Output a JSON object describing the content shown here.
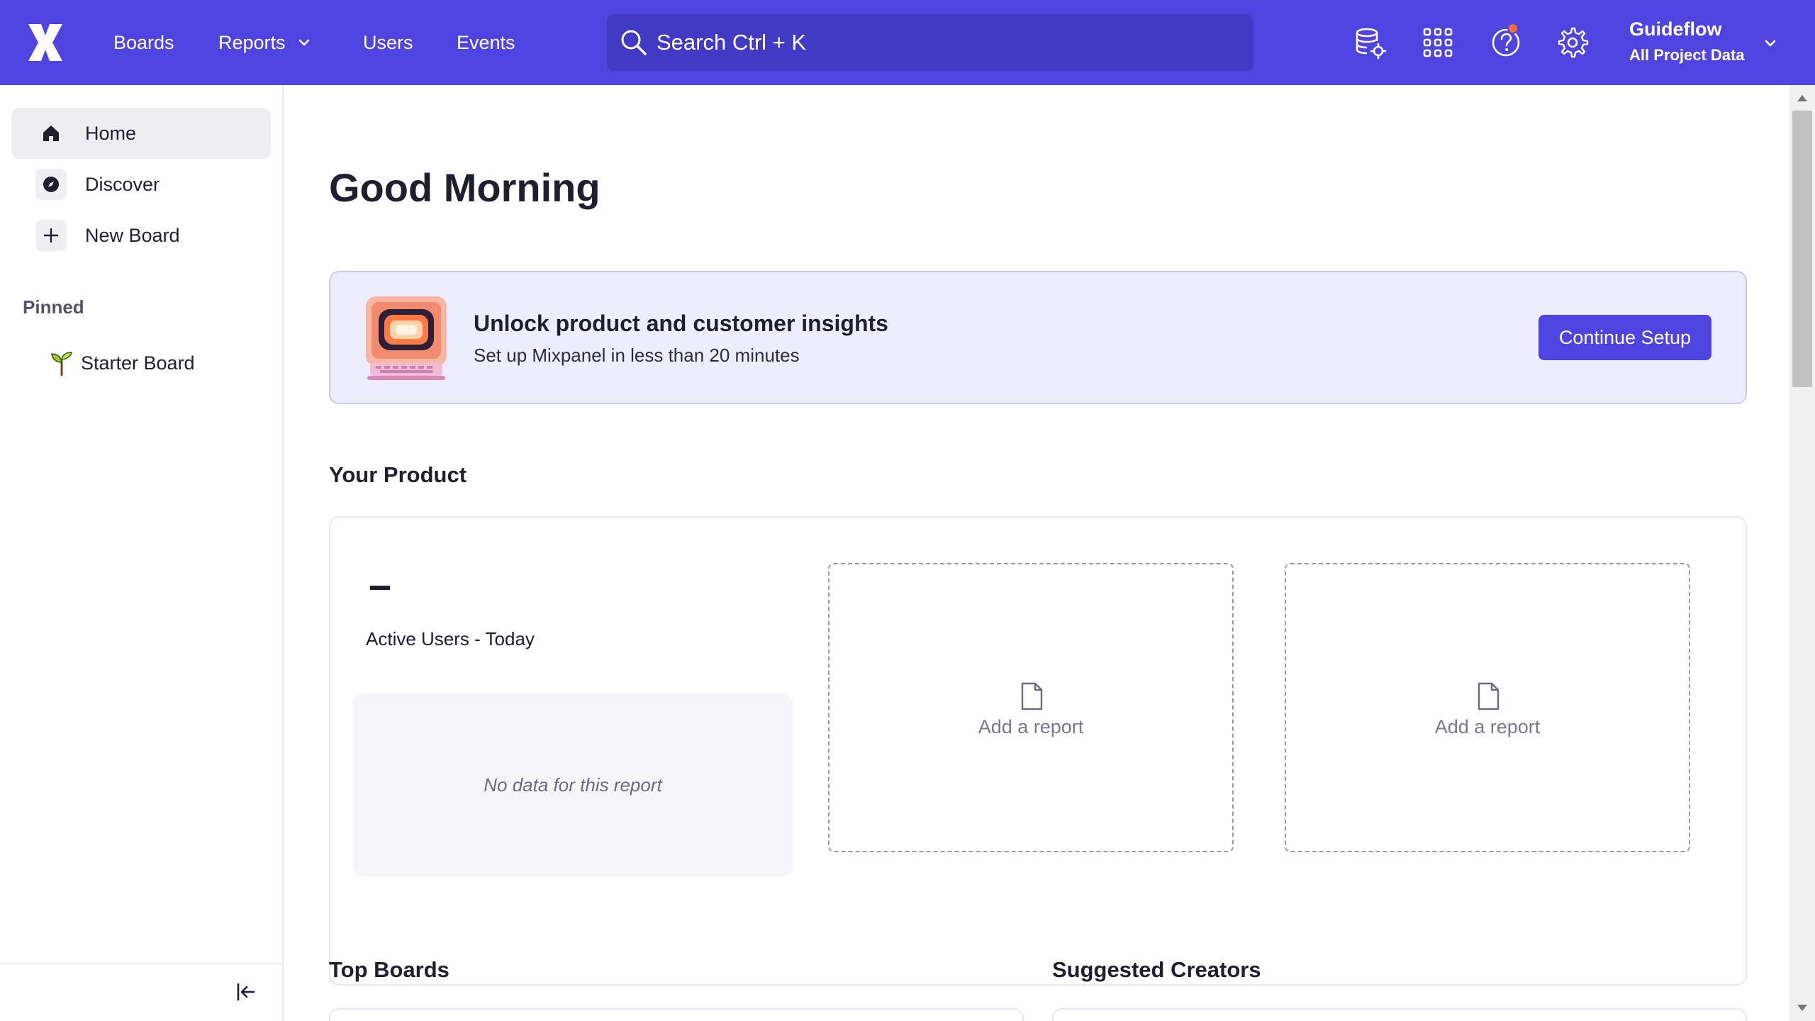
{
  "topbar": {
    "nav": {
      "boards": "Boards",
      "reports": "Reports",
      "users": "Users",
      "events": "Events"
    },
    "search": {
      "text": "Search  Ctrl + K"
    },
    "org": {
      "name": "Guideflow",
      "project": "All Project Data"
    },
    "icons": [
      "data-settings-icon",
      "apps-grid-icon",
      "help-icon",
      "gear-icon"
    ],
    "colors": {
      "bar": "#4f44e0",
      "search_bg": "#4239c4",
      "notification": "#ff6a3d"
    }
  },
  "sidebar": {
    "items": [
      {
        "label": "Home",
        "icon": "home-icon",
        "active": true
      },
      {
        "label": "Discover",
        "icon": "compass-icon"
      },
      {
        "label": "New Board",
        "icon": "plus-icon"
      }
    ],
    "pinned_label": "Pinned",
    "pinned": [
      {
        "label": "Starter Board",
        "icon": "sprout-icon"
      }
    ]
  },
  "main": {
    "greeting": "Good Morning",
    "banner": {
      "title": "Unlock product and customer insights",
      "subtitle": "Set up Mixpanel in less than 20 minutes",
      "cta": "Continue Setup"
    },
    "your_product": {
      "title": "Your Product",
      "metric_value": "–",
      "metric_label": "Active Users - Today",
      "no_data": "No data for this report",
      "add_report_label": "Add a report"
    },
    "top_boards_title": "Top Boards",
    "suggested_creators_title": "Suggested Creators"
  }
}
